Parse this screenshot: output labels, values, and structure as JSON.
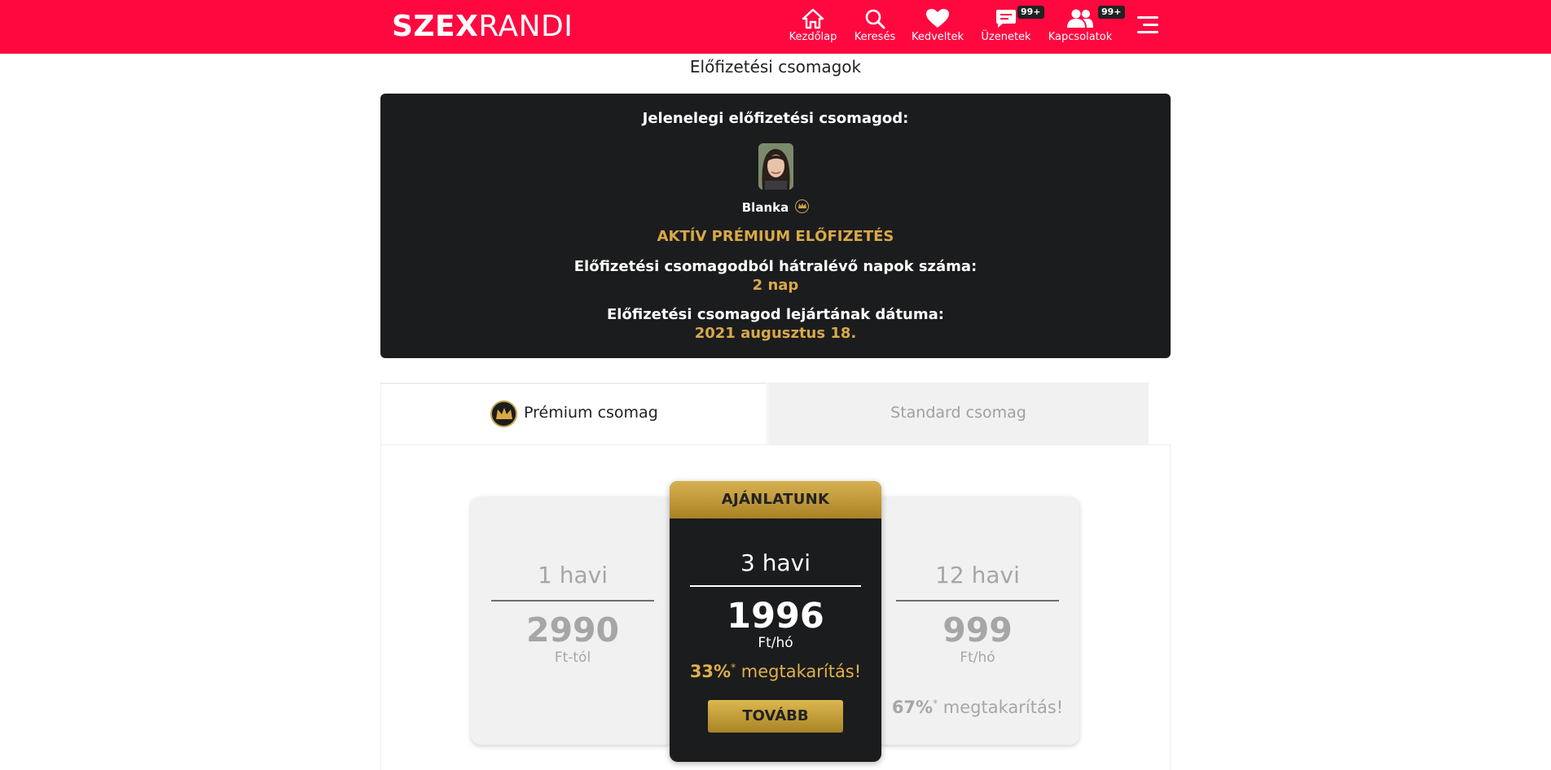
{
  "header": {
    "logo_bold": "SZEX",
    "logo_thin": "RANDI",
    "nav": [
      {
        "label": "Kezdőlap",
        "icon": "home-icon"
      },
      {
        "label": "Keresés",
        "icon": "search-icon"
      },
      {
        "label": "Kedveltek",
        "icon": "heart-icon"
      },
      {
        "label": "Üzenetek",
        "icon": "message-icon",
        "badge": "99+"
      },
      {
        "label": "Kapcsolatok",
        "icon": "users-icon",
        "badge": "99+"
      }
    ],
    "menu_icon": "hamburger-menu-icon",
    "colors": {
      "bar": "#ff0840",
      "text": "#ffffff"
    }
  },
  "page": {
    "title": "Előfizetési csomagok"
  },
  "status": {
    "current_label": "Jelenelegi előfizetési csomagod:",
    "user_name": "Blanka",
    "active_text": "AKTÍV PRÉMIUM ELŐFIZETÉS",
    "days_label": "Előfizetési csomagodból hátralévő napok száma:",
    "days_value": "2 nap",
    "expiry_label": "Előfizetési csomagod lejártának dátuma:",
    "expiry_value": "2021 augusztus 18.",
    "colors": {
      "panel": "#1b1c1e",
      "gold": "#d9a946"
    }
  },
  "tabs": [
    {
      "label": "Prémium csomag",
      "active": true
    },
    {
      "label": "Standard csomag",
      "active": false
    }
  ],
  "plans": {
    "left": {
      "period": "1 havi",
      "price": "2990",
      "unit": "Ft-tól"
    },
    "featured": {
      "ribbon": "AJÁNLATUNK",
      "period": "3 havi",
      "price": "1996",
      "unit": "Ft/hó",
      "save_pct": "33%",
      "save_star": "*",
      "save_text": "megtakarítás!",
      "button": "TOVÁBB"
    },
    "right": {
      "period": "12 havi",
      "price": "999",
      "unit": "Ft/hó",
      "save_pct": "67%",
      "save_star": "*",
      "save_text": "megtakarítás!"
    }
  }
}
